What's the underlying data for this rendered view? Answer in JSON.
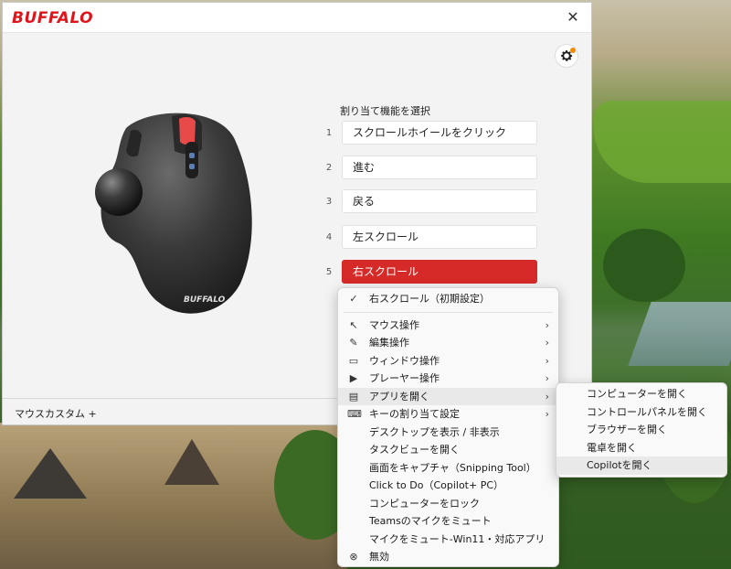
{
  "app": {
    "brand": "BUFFALO",
    "close_glyph": "✕"
  },
  "main": {
    "section_label": "割り当て機能を選択",
    "slots": [
      {
        "num": "1",
        "label": "スクロールホイールをクリック"
      },
      {
        "num": "2",
        "label": "進む"
      },
      {
        "num": "3",
        "label": "戻る"
      },
      {
        "num": "4",
        "label": "左スクロール"
      },
      {
        "num": "5",
        "label": "右スクロール"
      }
    ],
    "footer_label": "マウスカスタム +",
    "accent_color": "#d62a28"
  },
  "context_menu": {
    "items": [
      {
        "icon": "check-icon",
        "glyph": "✓",
        "label": "右スクロール（初期設定）",
        "arrow": ""
      },
      {
        "icon": "cursor-icon",
        "glyph": "↖",
        "label": "マウス操作",
        "arrow": "›"
      },
      {
        "icon": "pencil-icon",
        "glyph": "✎",
        "label": "編集操作",
        "arrow": "›"
      },
      {
        "icon": "window-icon",
        "glyph": "▭",
        "label": "ウィンドウ操作",
        "arrow": "›"
      },
      {
        "icon": "play-circle-icon",
        "glyph": "▶",
        "label": "プレーヤー操作",
        "arrow": "›"
      },
      {
        "icon": "briefcase-icon",
        "glyph": "▤",
        "label": "アプリを開く",
        "arrow": "›"
      },
      {
        "icon": "keyboard-icon",
        "glyph": "⌨",
        "label": "キーの割り当て設定",
        "arrow": "›"
      },
      {
        "icon": "",
        "glyph": "",
        "label": "デスクトップを表示 / 非表示",
        "arrow": ""
      },
      {
        "icon": "",
        "glyph": "",
        "label": "タスクビューを開く",
        "arrow": ""
      },
      {
        "icon": "",
        "glyph": "",
        "label": "画面をキャプチャ（Snipping Tool）",
        "arrow": ""
      },
      {
        "icon": "",
        "glyph": "",
        "label": "Click to Do（Copilot+ PC）",
        "arrow": ""
      },
      {
        "icon": "",
        "glyph": "",
        "label": "コンピューターをロック",
        "arrow": ""
      },
      {
        "icon": "",
        "glyph": "",
        "label": "Teamsのマイクをミュート",
        "arrow": ""
      },
      {
        "icon": "",
        "glyph": "",
        "label": "マイクをミュート-Win11・対応アプリ",
        "arrow": ""
      },
      {
        "icon": "disabled-icon",
        "glyph": "⊗",
        "label": "無効",
        "arrow": ""
      }
    ]
  },
  "submenu": {
    "items": [
      {
        "label": "コンピューターを開く"
      },
      {
        "label": "コントロールパネルを開く"
      },
      {
        "label": "ブラウザーを開く"
      },
      {
        "label": "電卓を開く"
      },
      {
        "label": "Copilotを開く"
      }
    ]
  }
}
